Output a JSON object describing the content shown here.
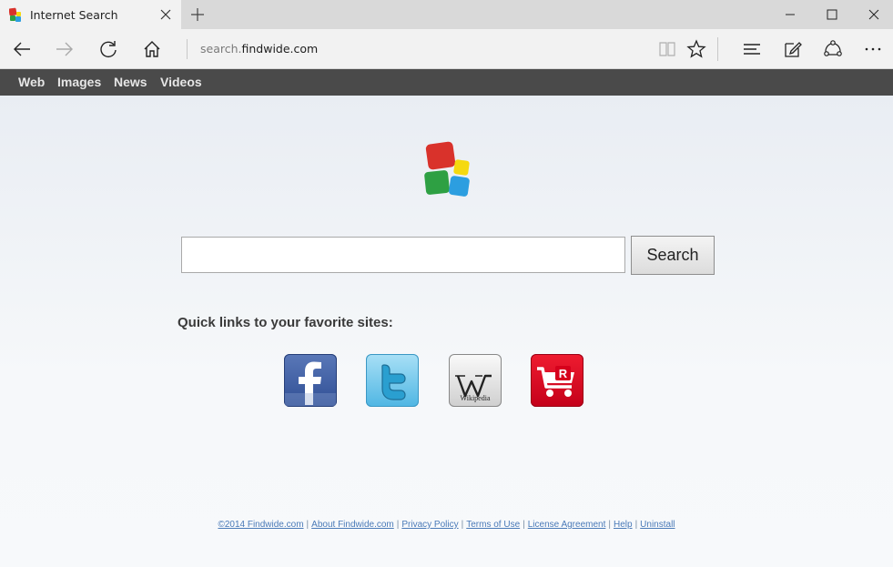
{
  "browser": {
    "tab_title": "Internet Search",
    "address_host_prefix": "search.",
    "address_host_domain": "findwide.com"
  },
  "site_nav": [
    "Web",
    "Images",
    "News",
    "Videos"
  ],
  "search": {
    "placeholder": "",
    "button_label": "Search"
  },
  "quick_links": {
    "title": "Quick links to your favorite sites:",
    "items": [
      {
        "name": "facebook",
        "icon": "facebook-icon",
        "color": "#3b5998"
      },
      {
        "name": "twitter",
        "icon": "twitter-icon",
        "color": "#5bc0e8"
      },
      {
        "name": "wikipedia",
        "icon": "wikipedia-icon",
        "color": "#e8e8e8",
        "text": "Wikipedia"
      },
      {
        "name": "rakuten",
        "icon": "rakuten-cart-icon",
        "color": "#d6001c"
      }
    ]
  },
  "footer": {
    "links": [
      "©2014 Findwide.com",
      "About Findwide.com",
      "Privacy Policy",
      "Terms of Use",
      "License Agreement",
      "Help",
      "Uninstall"
    ]
  },
  "colors": {
    "logo_red": "#d9322b",
    "logo_yellow": "#f5d90f",
    "logo_green": "#2ea043",
    "logo_blue": "#2c9ee0",
    "sitenav_bg": "#4a4a4a"
  }
}
